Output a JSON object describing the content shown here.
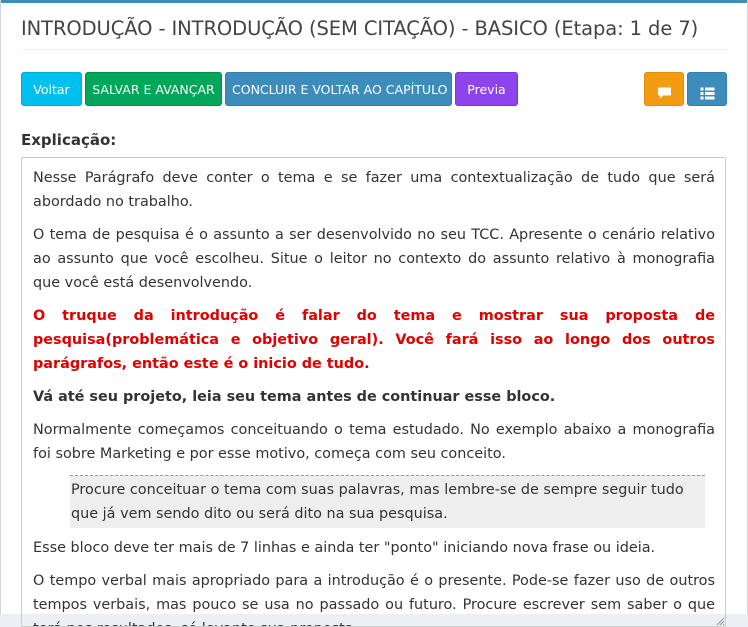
{
  "page": {
    "title": "INTRODUÇÃO - INTRODUÇÃO (SEM CITAÇÃO) - BASICO (Etapa: 1 de 7)"
  },
  "toolbar": {
    "voltar": "Voltar",
    "salvar": "SALVAR E AVANÇAR",
    "concluir": "CONCLUIR E VOLTAR AO CAPÍTULO",
    "previa": "Previa",
    "chat_icon": "comments-icon",
    "list_icon": "list-icon"
  },
  "colors": {
    "info": "#00c0ef",
    "success": "#00a65a",
    "primary": "#3c8dbc",
    "purple": "#8e44ec",
    "warning": "#f39c12",
    "emphasis_red": "#e00000"
  },
  "explanation": {
    "label": "Explicação:",
    "p1": "Nesse Parágrafo deve conter o tema e se fazer uma contextualização de tudo que será abordado no trabalho.",
    "p2": "O tema de pesquisa é o assunto a ser desenvolvido no seu TCC. Apresente o cenário relativo ao assunto que você escolheu. Situe o leitor no contexto do assunto relativo à monografia que você está desenvolvendo.",
    "p3": "O truque da introdução é falar do tema e mostrar sua proposta de pesquisa(problemática e objetivo geral). Você fará isso ao longo dos outros parágrafos, então este é o inicio de tudo.",
    "p4": "Vá até seu projeto, leia seu tema antes de continuar esse bloco.",
    "p5": "Normalmente começamos conceituando o tema estudado. No exemplo abaixo a monografia foi sobre Marketing e por esse motivo, começa com seu conceito.",
    "quote": "Procure conceituar o tema com suas palavras, mas lembre-se de sempre seguir tudo que já vem sendo dito ou será dito na sua pesquisa.",
    "p6": "Esse bloco deve ter mais de 7 linhas e ainda ter \"ponto\" iniciando nova frase ou ideia.",
    "p7": "O tempo verbal mais apropriado para a introdução é o presente. Pode-se fazer uso de outros tempos verbais, mas pouco se usa no passado ou futuro. Procure escrever sem saber o que terá nos resultados, só levante sua proposta."
  }
}
